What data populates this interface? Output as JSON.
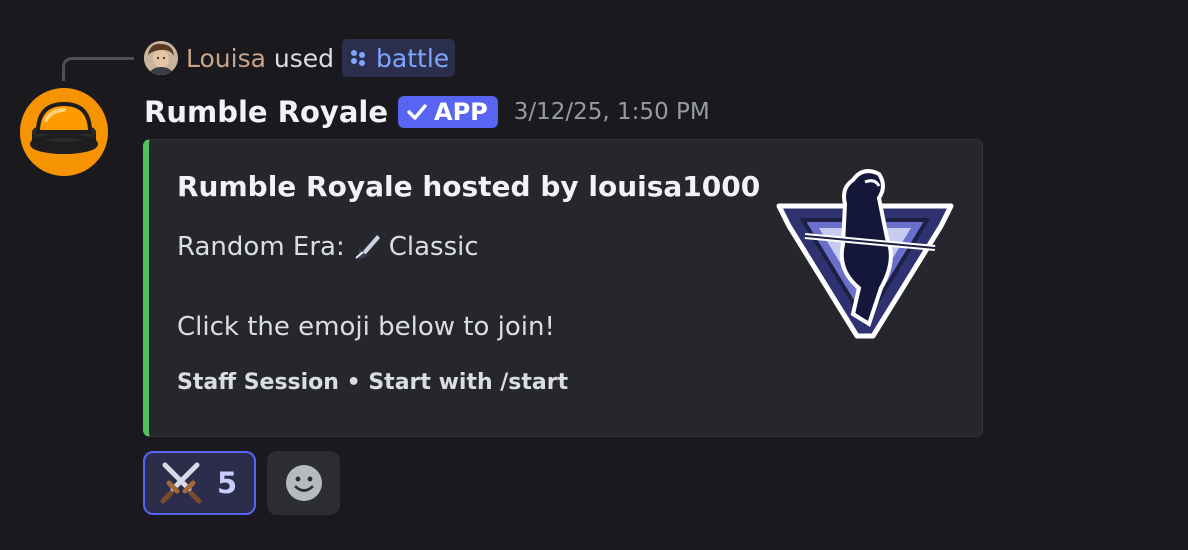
{
  "reply": {
    "user": "Louisa",
    "verb": "used",
    "command": "battle",
    "command_icon": "slash-command-icon"
  },
  "message": {
    "author": "Rumble Royale",
    "badge": "APP",
    "badge_icon": "checkmark-icon",
    "timestamp": "3/12/25, 1:50 PM"
  },
  "embed": {
    "accent_color": "#57c05a",
    "title": "Rumble Royale hosted by louisa1000",
    "era_label": "Random Era:",
    "era_value": "Classic",
    "era_icon": "quill-emoji",
    "instruction": "Click the emoji below to join!",
    "footer": "Staff Session • Start with /start",
    "thumbnail": "rumble-royale-knight-logo"
  },
  "reactions": [
    {
      "emoji": "crossed-swords-emoji",
      "count": "5",
      "active": true
    }
  ],
  "add_reaction_icon": "smiley-icon",
  "colors": {
    "background": "#1a1a1e",
    "brand": "#5865f2",
    "username": "#c9a48c",
    "command": "#7ea6ff"
  }
}
